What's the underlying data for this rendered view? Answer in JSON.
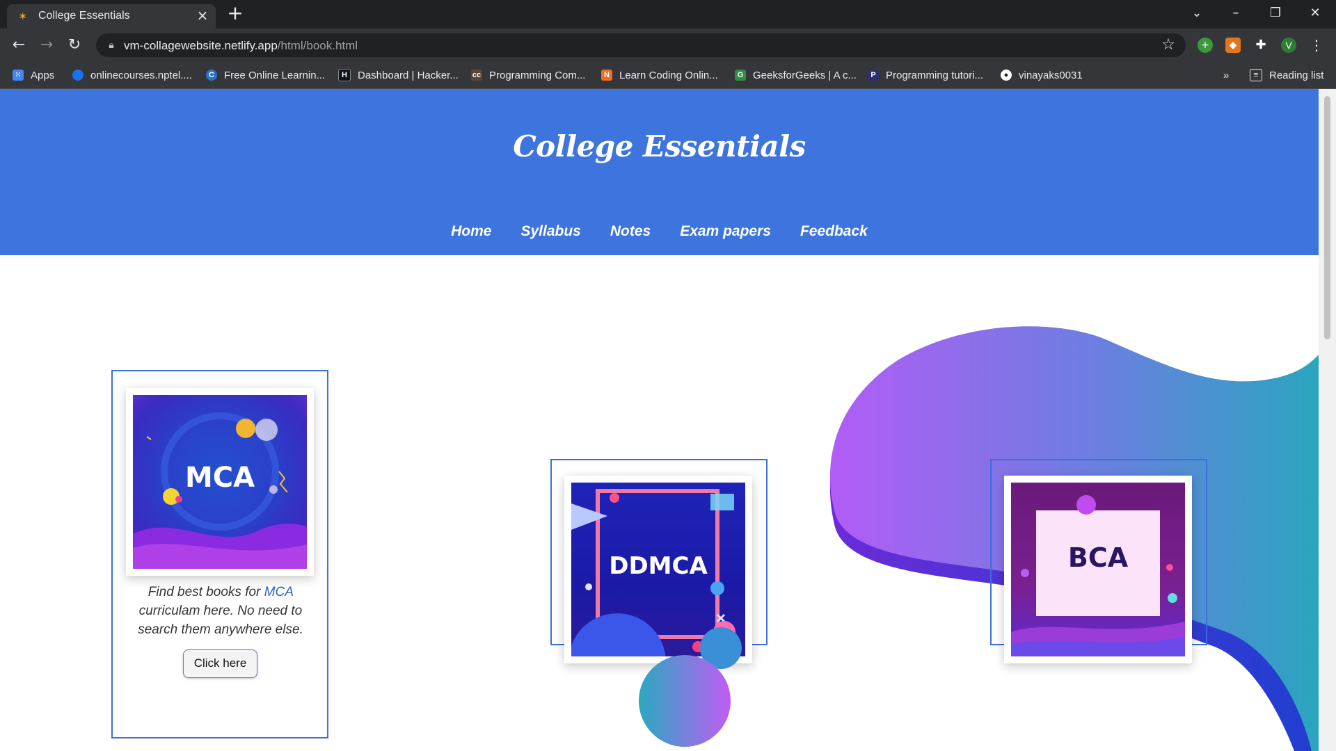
{
  "browser": {
    "tab_title": "College Essentials",
    "url_domain": "vm-collagewebsite.netlify.app",
    "url_path": "/html/book.html",
    "profile_initial": "V",
    "bookmarks": [
      {
        "label": "Apps",
        "icon": "apps-grid-icon",
        "color": "#4285f4"
      },
      {
        "label": "onlinecourses.nptel....",
        "icon": "nptel-icon",
        "color": "#1a73e8"
      },
      {
        "label": "Free Online Learnin...",
        "icon": "coursera-icon",
        "color": "#2a73cc"
      },
      {
        "label": "Dashboard | Hacker...",
        "icon": "hackerrank-icon",
        "color": "#0e141e"
      },
      {
        "label": "Programming Com...",
        "icon": "codechef-icon",
        "color": "#5b4638"
      },
      {
        "label": "Learn Coding Onlin...",
        "icon": "codingninjas-icon",
        "color": "#f26c22"
      },
      {
        "label": "GeeksforGeeks | A c...",
        "icon": "gfg-icon",
        "color": "#2f8d46"
      },
      {
        "label": "Programming tutori...",
        "icon": "programiz-icon",
        "color": "#2b2f6b"
      },
      {
        "label": "vinayaks0031",
        "icon": "github-icon",
        "color": "#ffffff"
      }
    ],
    "reading_list": "Reading list"
  },
  "site": {
    "title": "College Essentials",
    "nav": [
      "Home",
      "Syllabus",
      "Notes",
      "Exam papers",
      "Feedback"
    ]
  },
  "cards": [
    {
      "cover": "MCA",
      "desc_prefix": "Find best books for ",
      "desc_highlight": "MCA",
      "desc_suffix": " curriculam here. No need to search them anywhere else.",
      "button": "Click here"
    },
    {
      "cover": "DDMCA"
    },
    {
      "cover": "BCA"
    }
  ],
  "colors": {
    "header": "#3d74dd",
    "card_border": "#3d6fd8",
    "blob_purple": "#b05cf5",
    "blob_teal": "#2aa3c0"
  }
}
